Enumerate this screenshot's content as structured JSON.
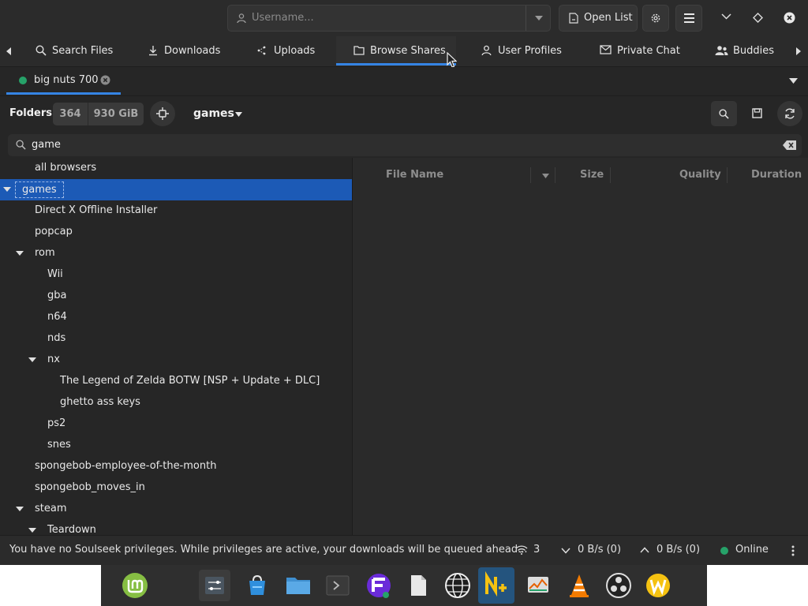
{
  "header": {
    "username_placeholder": "Username...",
    "open_list_label": "Open List"
  },
  "tabs": [
    {
      "label": "Search Files",
      "icon": "search-icon"
    },
    {
      "label": "Downloads",
      "icon": "download-icon"
    },
    {
      "label": "Uploads",
      "icon": "upload-icon"
    },
    {
      "label": "Browse Shares",
      "icon": "folder-icon",
      "active": true
    },
    {
      "label": "User Profiles",
      "icon": "user-icon"
    },
    {
      "label": "Private Chat",
      "icon": "mail-icon"
    },
    {
      "label": "Buddies",
      "icon": "buddies-icon"
    }
  ],
  "user_tab": {
    "label": "big nuts 700",
    "status_color": "#26a269"
  },
  "toolbar": {
    "folders_label": "Folders",
    "folder_count": "364",
    "share_size": "930 GiB",
    "current_folder": "games"
  },
  "filter": {
    "value": "game"
  },
  "tree": [
    {
      "label": "all browsers",
      "depth": 1
    },
    {
      "label": "games",
      "depth": 0,
      "expanded": true,
      "selected": true
    },
    {
      "label": "Direct X Offline Installer",
      "depth": 1
    },
    {
      "label": "popcap",
      "depth": 1
    },
    {
      "label": "rom",
      "depth": 1,
      "expanded": true
    },
    {
      "label": "Wii",
      "depth": 2
    },
    {
      "label": "gba",
      "depth": 2
    },
    {
      "label": "n64",
      "depth": 2
    },
    {
      "label": "nds",
      "depth": 2
    },
    {
      "label": "nx",
      "depth": 2,
      "expanded": true
    },
    {
      "label": "The Legend of Zelda BOTW [NSP + Update + DLC]",
      "depth": 3
    },
    {
      "label": "ghetto ass keys",
      "depth": 3
    },
    {
      "label": "ps2",
      "depth": 2
    },
    {
      "label": "snes",
      "depth": 2
    },
    {
      "label": "spongebob-employee-of-the-month",
      "depth": 1
    },
    {
      "label": "spongebob_moves_in",
      "depth": 1
    },
    {
      "label": "steam",
      "depth": 1,
      "expanded": true
    },
    {
      "label": "Teardown",
      "depth": 2,
      "expanded": true
    }
  ],
  "file_columns": {
    "name": "File Name",
    "size": "Size",
    "quality": "Quality",
    "duration": "Duration"
  },
  "status": {
    "message": "You have no Soulseek privileges. While privileges are active, your downloads will be queued ahead...",
    "connections": "3",
    "download_speed": "0 B/s (0)",
    "upload_speed": "0 B/s (0)",
    "online_label": "Online",
    "online_color": "#26a269"
  },
  "colors": {
    "accent": "#3584e4",
    "selection": "#1c5ab6"
  }
}
